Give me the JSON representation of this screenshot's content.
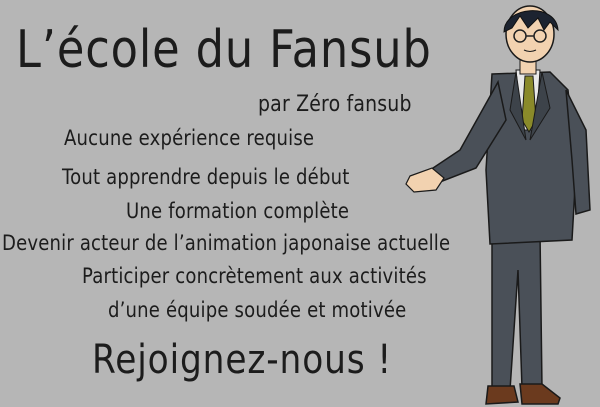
{
  "poster": {
    "title": "L’école du Fansub",
    "subtitle": "par Zéro fansub",
    "lines": [
      "Aucune expérience requise",
      "Tout apprendre depuis le début",
      "Une formation complète",
      "Devenir acteur de l’animation japonaise actuelle",
      "Participer concrètement aux activités",
      "d’une équipe soudée et motivée"
    ],
    "call_to_action": "Rejoignez-nous !"
  },
  "colors": {
    "background": "#b6b6b6",
    "text": "#1c1c1c",
    "suit": "#4a5058",
    "tie": "#8a8a2a",
    "shoes": "#6b3a1e"
  },
  "illustration": {
    "icon": "anime-character-in-suit-icon"
  }
}
